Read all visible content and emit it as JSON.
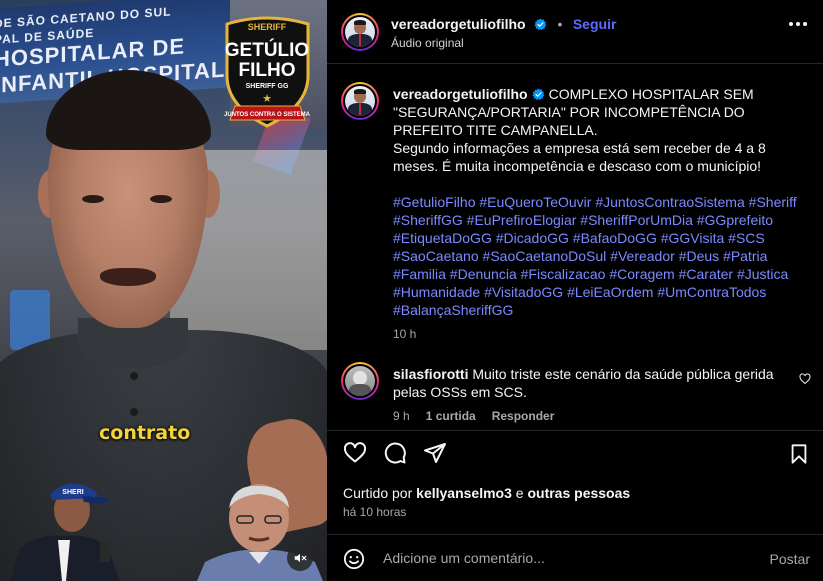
{
  "video": {
    "bg_sign_lines": [
      "DE SÃO CAETANO DO SUL",
      "PAL DE SAÚDE",
      "HOSPITALAR DE",
      "INFANTIL HOSPITALAR DE CLÍN"
    ],
    "badge": {
      "top": "SHERIFF",
      "line1": "GETÚLIO",
      "line2": "FILHO",
      "line3": "SHERIFF GG",
      "ribbon": "JUNTOS CONTRA O SISTEMA"
    },
    "caption_word": "contrato",
    "cap_text": "SHERI",
    "mute_icon": "muted-speaker-icon"
  },
  "header": {
    "username": "vereadorgetuliofilho",
    "separator": "•",
    "follow_label": "Seguir",
    "audio_label": "Áudio original",
    "more_icon": "more-options-icon"
  },
  "post": {
    "username": "vereadorgetuliofilho",
    "caption_line1": "COMPLEXO HOSPITALAR SEM \"SEGURANÇA/PORTARIA\" POR INCOMPETÊNCIA DO PREFEITO TITE CAMPANELLA.",
    "caption_line2": "Segundo informações a empresa está sem receber de 4 a 8 meses. É muita incompetência e descaso com o município!",
    "hashtags": [
      "#GetulioFilho",
      "#EuQueroTeOuvir",
      "#JuntosContraoSistema",
      "#Sheriff",
      "#SheriffGG",
      "#EuPrefiroElogiar",
      "#SheriffPorUmDia",
      "#GGprefeito",
      "#EtiquetaDoGG",
      "#DicadoGG",
      "#BafaoDoGG",
      "#GGVisita",
      "#SCS",
      "#SaoCaetano",
      "#SaoCaetanoDoSul",
      "#Vereador",
      "#Deus",
      "#Patria",
      "#Familia",
      "#Denuncia",
      "#Fiscalizacao",
      "#Coragem",
      "#Carater",
      "#Justica",
      "#Humanidade",
      "#VisitadoGG",
      "#LeiEaOrdem",
      "#UmContraTodos",
      "#BalançaSheriffGG"
    ],
    "time": "10 h"
  },
  "comment": {
    "username": "silasfiorotti",
    "text": "Muito triste este cenário da saúde pública gerida pelas OSSs em SCS.",
    "time": "9 h",
    "likes": "1 curtida",
    "reply": "Responder"
  },
  "actions": {
    "liked_by_prefix": "Curtido por",
    "liked_by_user": "kellyanselmo3",
    "liked_by_and": "e",
    "liked_by_others": "outras pessoas",
    "time_ago": "há 10 horas"
  },
  "composer": {
    "placeholder": "Adicione um comentário...",
    "post_label": "Postar"
  },
  "colors": {
    "accent_blue": "#5b6bff",
    "hashtag": "#7b8aff",
    "muted_text": "#a8a8a8",
    "caption_yellow": "#f1d33a"
  }
}
